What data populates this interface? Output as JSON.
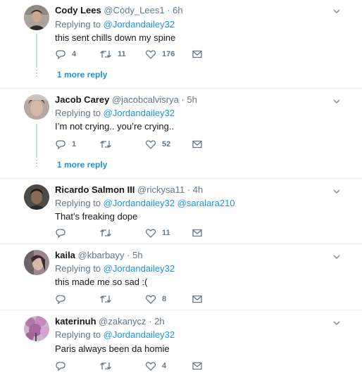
{
  "tweets": [
    {
      "name": "Cody Lees",
      "handle": "@Cody_Lees1",
      "time": "6h",
      "reply_prefix": "Replying to",
      "reply_mentions": [
        "@Jordandailey32"
      ],
      "text": "this sent chills down my spine",
      "reply_count": "4",
      "retweet_count": "11",
      "like_count": "176",
      "more_replies": "1 more reply"
    },
    {
      "name": "Jacob Carey",
      "handle": "@jacobcalvisrya",
      "time": "5h",
      "reply_prefix": "Replying to",
      "reply_mentions": [
        "@Jordandailey32"
      ],
      "text": "I’m not crying.. you’re crying..",
      "reply_count": "1",
      "retweet_count": "",
      "like_count": "52",
      "more_replies": "1 more reply"
    },
    {
      "name": "Ricardo Salmon III",
      "handle": "@rickysa11",
      "time": "4h",
      "reply_prefix": "Replying to",
      "reply_mentions": [
        "@Jordandailey32",
        "@saralara210"
      ],
      "text": "That's freaking dope",
      "reply_count": "",
      "retweet_count": "",
      "like_count": "11"
    },
    {
      "name": "kaila",
      "handle": "@kbarbayy",
      "time": "5h",
      "reply_prefix": "Replying to",
      "reply_mentions": [
        "@Jordandailey32"
      ],
      "text": "this made me so sad :(",
      "reply_count": "",
      "retweet_count": "",
      "like_count": "8"
    },
    {
      "name": "katerinuh",
      "handle": "@zakanycz",
      "time": "2h",
      "reply_prefix": "Replying to",
      "reply_mentions": [
        "@Jordandailey32"
      ],
      "text": "Paris always been da homie",
      "reply_count": "",
      "retweet_count": "",
      "like_count": "4"
    }
  ],
  "separator": "·",
  "icons": [
    "chevron-down-icon",
    "reply-icon",
    "retweet-icon",
    "like-icon",
    "direct-message-icon"
  ],
  "colors": {
    "link": "#1b95e0",
    "muted": "#657786",
    "thread": "#c5dcee",
    "divider": "#e6ecf0"
  }
}
